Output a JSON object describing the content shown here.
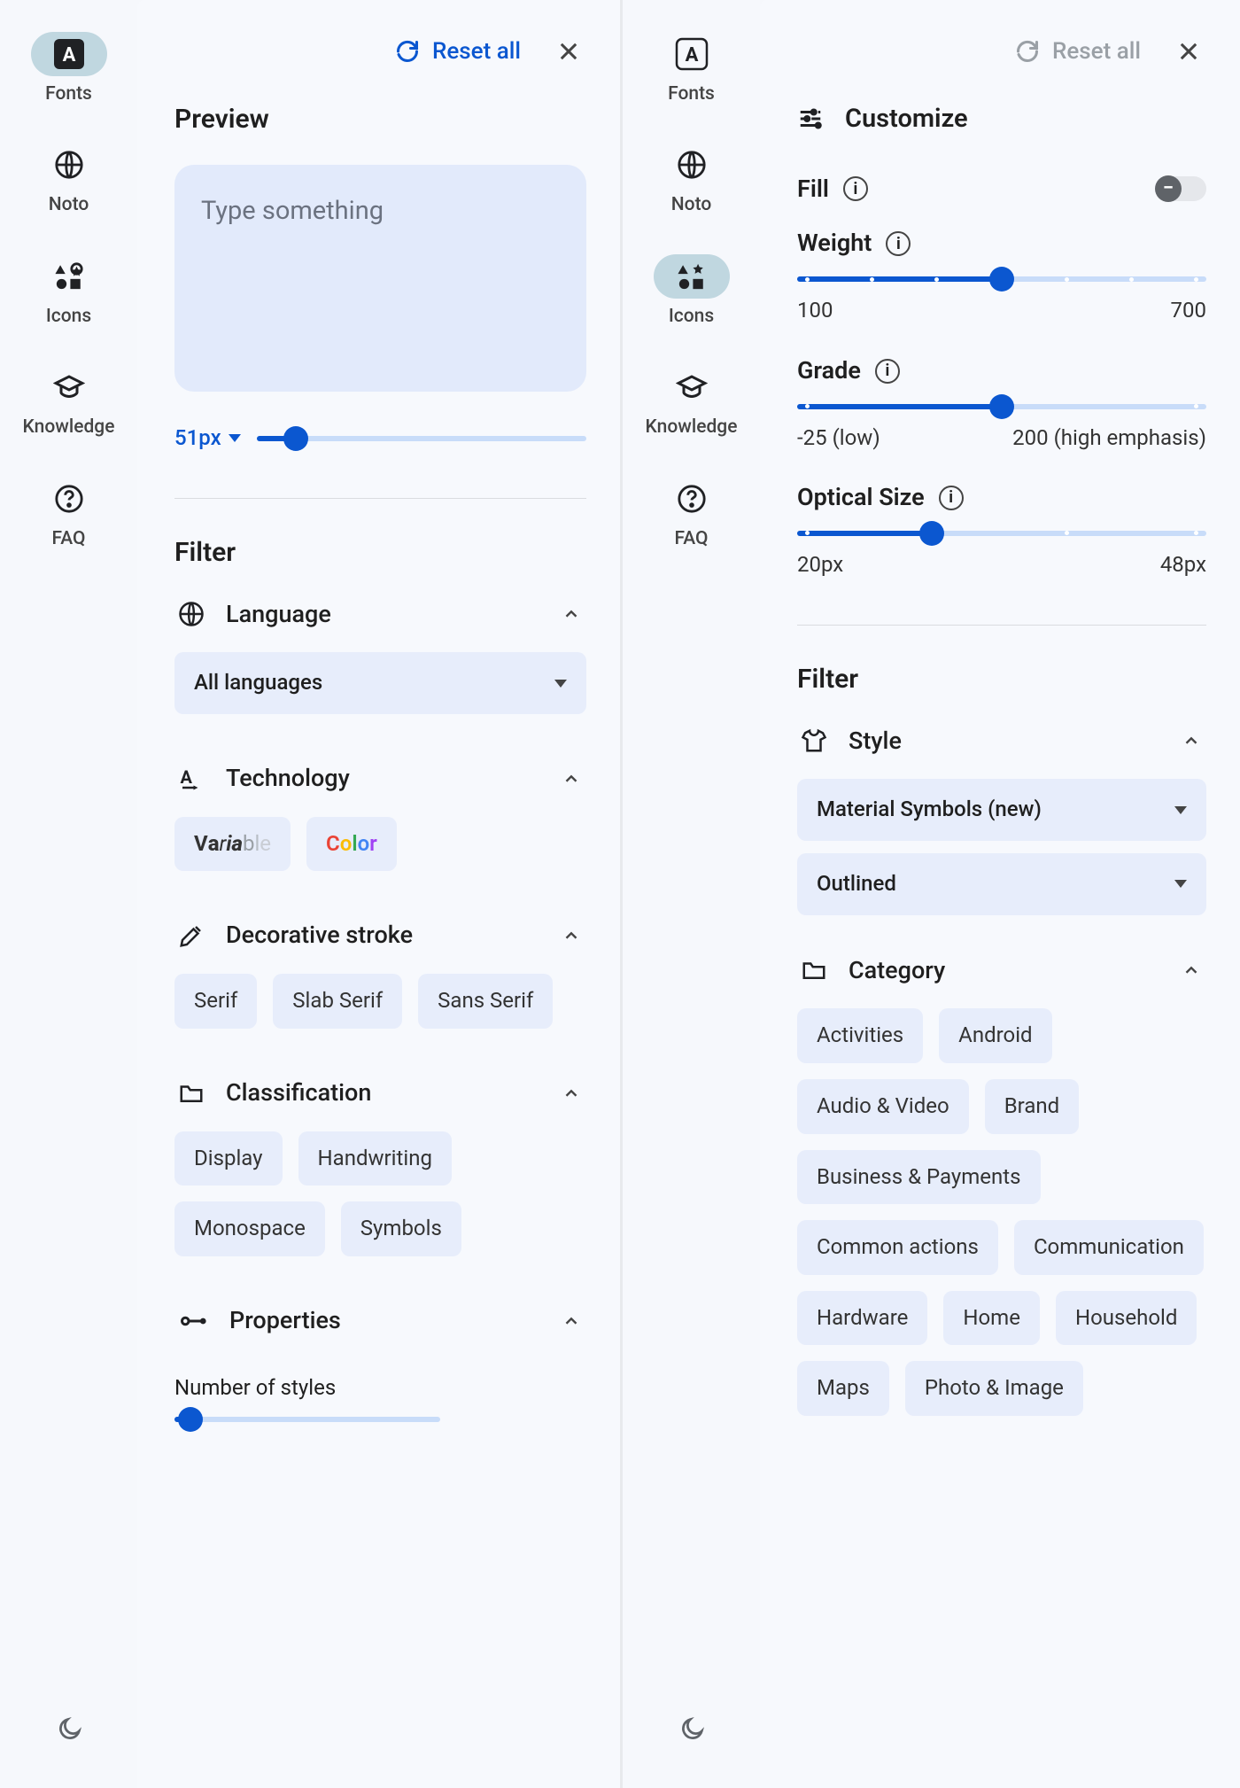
{
  "nav": {
    "fonts": "Fonts",
    "noto": "Noto",
    "icons": "Icons",
    "knowledge": "Knowledge",
    "faq": "FAQ"
  },
  "left": {
    "reset": "Reset all",
    "preview_heading": "Preview",
    "preview_placeholder": "Type something",
    "preview_size": "51px",
    "filter_heading": "Filter",
    "language_heading": "Language",
    "language_select": "All languages",
    "technology_heading": "Technology",
    "tech_variable": [
      "V",
      "a",
      "r",
      "i",
      "a",
      "b",
      "l",
      "e"
    ],
    "tech_color": [
      "C",
      "o",
      "l",
      "o",
      "r"
    ],
    "stroke_heading": "Decorative stroke",
    "stroke_chips": [
      "Serif",
      "Slab Serif",
      "Sans Serif"
    ],
    "classification_heading": "Classification",
    "classification_chips": [
      "Display",
      "Handwriting",
      "Monospace",
      "Symbols"
    ],
    "properties_heading": "Properties",
    "num_styles_label": "Number of styles"
  },
  "right": {
    "reset": "Reset all",
    "customize_heading": "Customize",
    "fill_label": "Fill",
    "weight_label": "Weight",
    "weight_min": "100",
    "weight_max": "700",
    "grade_label": "Grade",
    "grade_min": "-25 (low)",
    "grade_max": "200 (high emphasis)",
    "optical_label": "Optical Size",
    "optical_min": "20px",
    "optical_max": "48px",
    "filter_heading": "Filter",
    "style_heading": "Style",
    "style_select_a": "Material Symbols (new)",
    "style_select_b": "Outlined",
    "category_heading": "Category",
    "categories": [
      "Activities",
      "Android",
      "Audio & Video",
      "Brand",
      "Business & Payments",
      "Common actions",
      "Communication",
      "Hardware",
      "Home",
      "Household",
      "Maps",
      "Photo & Image"
    ]
  }
}
